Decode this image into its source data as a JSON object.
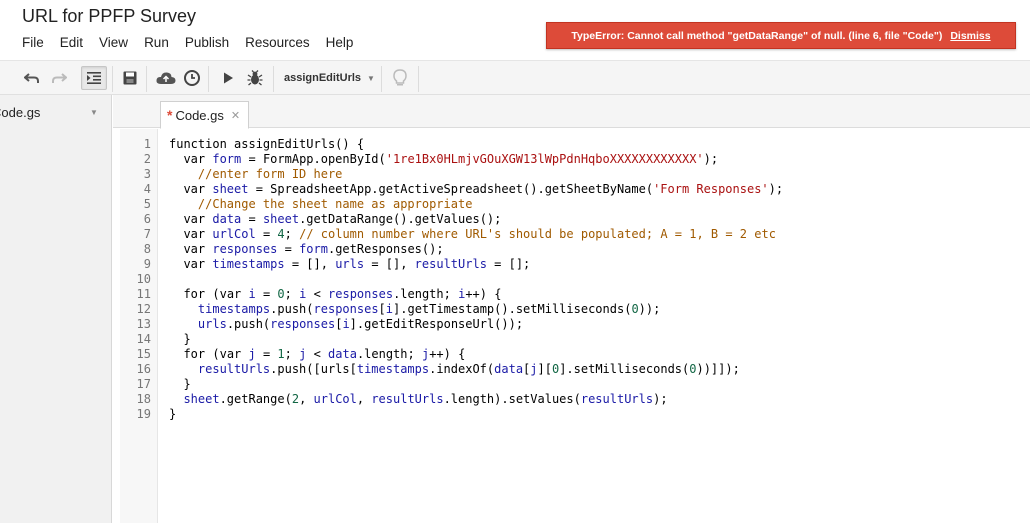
{
  "document": {
    "title": "URL for PPFP Survey"
  },
  "menu": [
    "File",
    "Edit",
    "View",
    "Run",
    "Publish",
    "Resources",
    "Help"
  ],
  "error": {
    "message": "TypeError: Cannot call method \"getDataRange\" of null. (line 6, file \"Code\")",
    "dismiss_label": "Dismiss",
    "color": "#dd4b39"
  },
  "toolbar": {
    "icons": [
      "undo-icon",
      "redo-icon",
      "indent-icon",
      "save-icon",
      "triggers-icon",
      "current-project-triggers-icon",
      "run-icon",
      "debug-icon",
      "lightbulb-icon"
    ],
    "function_select": "assignEditUrls"
  },
  "files": [
    {
      "name": "Code.gs"
    }
  ],
  "tabs": [
    {
      "label": "Code.gs",
      "modified": true
    }
  ],
  "code": {
    "lines": [
      [
        [
          "t-kw",
          "function "
        ],
        [
          "t-fn",
          "assignEditUrls() {"
        ]
      ],
      [
        [
          "t-kw",
          "  var "
        ],
        [
          "t-var",
          "form"
        ],
        [
          "t-p",
          " = FormApp.openById("
        ],
        [
          "t-str",
          "'1re1Bx0HLmjvGOuXGW13lWpPdnHqboXXXXXXXXXXXX'"
        ],
        [
          "t-p",
          ");"
        ]
      ],
      [
        [
          "t-cm",
          "    //enter form ID here"
        ]
      ],
      [
        [
          "t-kw",
          "  var "
        ],
        [
          "t-var",
          "sheet"
        ],
        [
          "t-p",
          " = SpreadsheetApp.getActiveSpreadsheet().getSheetByName("
        ],
        [
          "t-str",
          "'Form Responses'"
        ],
        [
          "t-p",
          ");"
        ]
      ],
      [
        [
          "t-cm",
          "    //Change the sheet name as appropriate"
        ]
      ],
      [
        [
          "t-kw",
          "  var "
        ],
        [
          "t-var",
          "data"
        ],
        [
          "t-p",
          " = "
        ],
        [
          "t-var",
          "sheet"
        ],
        [
          "t-p",
          ".getDataRange().getValues();"
        ]
      ],
      [
        [
          "t-kw",
          "  var "
        ],
        [
          "t-var",
          "urlCol"
        ],
        [
          "t-p",
          " = "
        ],
        [
          "t-num",
          "4"
        ],
        [
          "t-p",
          "; "
        ],
        [
          "t-cm",
          "// column number where URL's should be populated; A = 1, B = 2 etc"
        ]
      ],
      [
        [
          "t-kw",
          "  var "
        ],
        [
          "t-var",
          "responses"
        ],
        [
          "t-p",
          " = "
        ],
        [
          "t-var",
          "form"
        ],
        [
          "t-p",
          ".getResponses();"
        ]
      ],
      [
        [
          "t-kw",
          "  var "
        ],
        [
          "t-var",
          "timestamps"
        ],
        [
          "t-p",
          " = [], "
        ],
        [
          "t-var",
          "urls"
        ],
        [
          "t-p",
          " = [], "
        ],
        [
          "t-var",
          "resultUrls"
        ],
        [
          "t-p",
          " = [];"
        ]
      ],
      [
        [
          "t-p",
          ""
        ]
      ],
      [
        [
          "t-kw",
          "  for "
        ],
        [
          "t-p",
          "("
        ],
        [
          "t-kw",
          "var "
        ],
        [
          "t-var",
          "i"
        ],
        [
          "t-p",
          " = "
        ],
        [
          "t-num",
          "0"
        ],
        [
          "t-p",
          "; "
        ],
        [
          "t-var",
          "i"
        ],
        [
          "t-p",
          " < "
        ],
        [
          "t-var",
          "responses"
        ],
        [
          "t-p",
          ".length; "
        ],
        [
          "t-var",
          "i"
        ],
        [
          "t-p",
          "++) {"
        ]
      ],
      [
        [
          "t-p",
          "    "
        ],
        [
          "t-var",
          "timestamps"
        ],
        [
          "t-p",
          ".push("
        ],
        [
          "t-var",
          "responses"
        ],
        [
          "t-p",
          "["
        ],
        [
          "t-var",
          "i"
        ],
        [
          "t-p",
          "].getTimestamp().setMilliseconds("
        ],
        [
          "t-num",
          "0"
        ],
        [
          "t-p",
          "));"
        ]
      ],
      [
        [
          "t-p",
          "    "
        ],
        [
          "t-var",
          "urls"
        ],
        [
          "t-p",
          ".push("
        ],
        [
          "t-var",
          "responses"
        ],
        [
          "t-p",
          "["
        ],
        [
          "t-var",
          "i"
        ],
        [
          "t-p",
          "].getEditResponseUrl());"
        ]
      ],
      [
        [
          "t-p",
          "  }"
        ]
      ],
      [
        [
          "t-kw",
          "  for "
        ],
        [
          "t-p",
          "("
        ],
        [
          "t-kw",
          "var "
        ],
        [
          "t-var",
          "j"
        ],
        [
          "t-p",
          " = "
        ],
        [
          "t-num",
          "1"
        ],
        [
          "t-p",
          "; "
        ],
        [
          "t-var",
          "j"
        ],
        [
          "t-p",
          " < "
        ],
        [
          "t-var",
          "data"
        ],
        [
          "t-p",
          ".length; "
        ],
        [
          "t-var",
          "j"
        ],
        [
          "t-p",
          "++) {"
        ]
      ],
      [
        [
          "t-p",
          "    "
        ],
        [
          "t-var",
          "resultUrls"
        ],
        [
          "t-p",
          ".push([urls["
        ],
        [
          "t-var",
          "timestamps"
        ],
        [
          "t-p",
          ".indexOf("
        ],
        [
          "t-var",
          "data"
        ],
        [
          "t-p",
          "["
        ],
        [
          "t-var",
          "j"
        ],
        [
          "t-p",
          "]["
        ],
        [
          "t-num",
          "0"
        ],
        [
          "t-p",
          "].setMilliseconds("
        ],
        [
          "t-num",
          "0"
        ],
        [
          "t-p",
          "))]]);"
        ]
      ],
      [
        [
          "t-p",
          "  }"
        ]
      ],
      [
        [
          "t-p",
          "  "
        ],
        [
          "t-var",
          "sheet"
        ],
        [
          "t-p",
          ".getRange("
        ],
        [
          "t-num",
          "2"
        ],
        [
          "t-p",
          ", "
        ],
        [
          "t-var",
          "urlCol"
        ],
        [
          "t-p",
          ", "
        ],
        [
          "t-var",
          "resultUrls"
        ],
        [
          "t-p",
          ".length).setValues("
        ],
        [
          "t-var",
          "resultUrls"
        ],
        [
          "t-p",
          ");"
        ]
      ],
      [
        [
          "t-p",
          "}"
        ]
      ]
    ]
  }
}
